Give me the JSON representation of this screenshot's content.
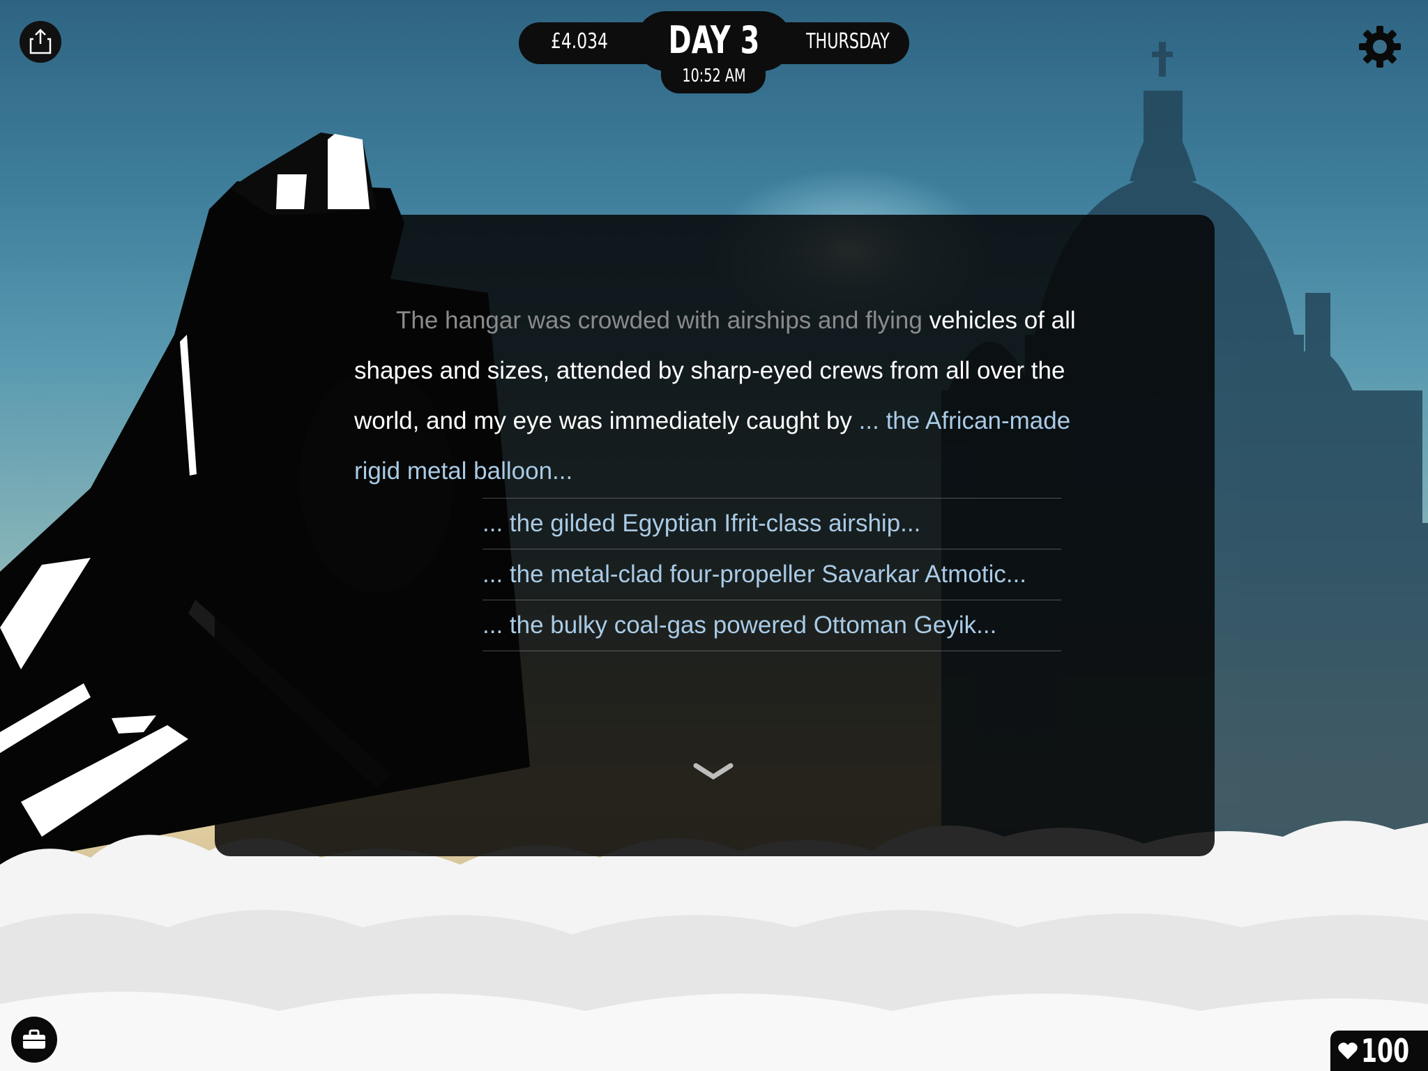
{
  "hud": {
    "money": "£4.034",
    "day": "DAY 3",
    "time": "10:52 AM",
    "weekday": "THURSDAY"
  },
  "story": {
    "faded_text": "The hangar was crowded with airships and flying",
    "text": "vehicles of all shapes and sizes, attended by sharp-eyed crews from all over the world, and my eye was immediately caught by",
    "choices": [
      "... the African-made rigid metal balloon...",
      "... the gilded Egyptian Ifrit-class airship...",
      "... the metal-clad four-propeller Savarkar Atmotic...",
      "... the bulky coal-gas powered Ottoman Geyik..."
    ]
  },
  "status": {
    "health": "100"
  },
  "icons": {
    "share": "share-icon",
    "settings": "gear-icon",
    "inventory": "briefcase-icon",
    "health": "heart-icon",
    "more": "chevron-down-icon"
  }
}
